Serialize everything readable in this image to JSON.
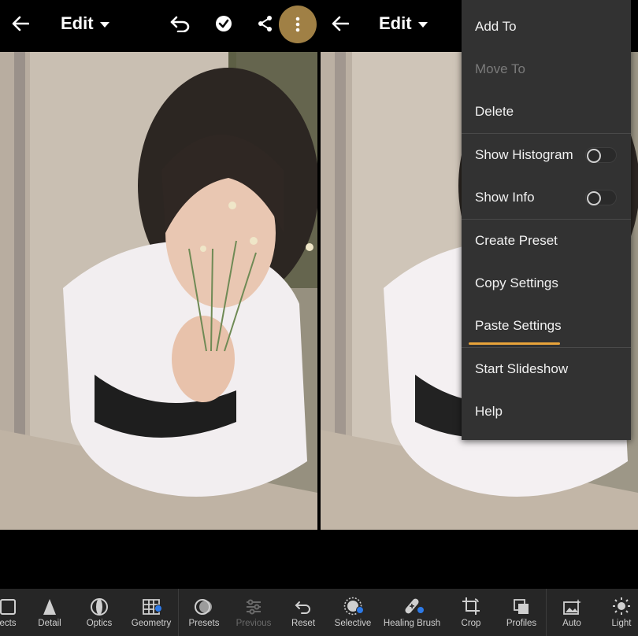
{
  "left_pane": {
    "edit_label": "Edit"
  },
  "right_pane": {
    "edit_label": "Edit"
  },
  "menu": {
    "items": [
      {
        "label": "Add To",
        "enabled": true
      },
      {
        "label": "Move To",
        "enabled": false
      },
      {
        "label": "Delete",
        "enabled": true
      },
      {
        "label": "Show Histogram",
        "toggle": false
      },
      {
        "label": "Show Info",
        "toggle": false
      },
      {
        "label": "Create Preset",
        "enabled": true
      },
      {
        "label": "Copy Settings",
        "enabled": true
      },
      {
        "label": "Paste Settings",
        "enabled": true,
        "highlighted": true
      },
      {
        "label": "Start Slideshow",
        "enabled": true
      },
      {
        "label": "Help",
        "enabled": true
      }
    ]
  },
  "toolbar": {
    "items": [
      {
        "label": "ects",
        "icon": "effects-icon"
      },
      {
        "label": "Detail",
        "icon": "detail-icon"
      },
      {
        "label": "Optics",
        "icon": "optics-icon"
      },
      {
        "label": "Geometry",
        "icon": "geometry-icon"
      },
      {
        "label": "Presets",
        "icon": "presets-icon"
      },
      {
        "label": "Previous",
        "icon": "previous-icon",
        "disabled": true
      },
      {
        "label": "Reset",
        "icon": "reset-icon"
      },
      {
        "label": "Selective",
        "icon": "selective-icon"
      },
      {
        "label": "Healing Brush",
        "icon": "healing-brush-icon"
      },
      {
        "label": "Crop",
        "icon": "crop-icon"
      },
      {
        "label": "Profiles",
        "icon": "profiles-icon"
      },
      {
        "label": "Auto",
        "icon": "auto-icon"
      },
      {
        "label": "Light",
        "icon": "light-icon"
      }
    ]
  },
  "colors": {
    "accent": "#e8a33a",
    "menu_bg": "#323232",
    "more_active": "#a08045",
    "badge": "#2d7ae8"
  }
}
